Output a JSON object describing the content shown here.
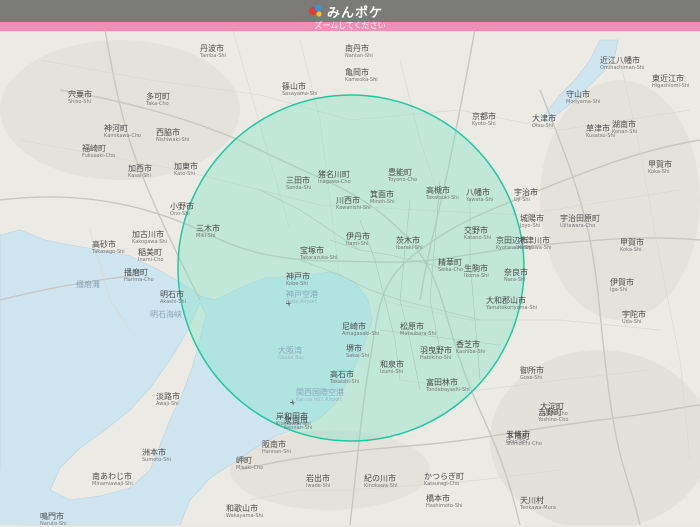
{
  "app": {
    "logo_text": "みんポケ",
    "notice": "ズームしてください",
    "colors": {
      "topbar": "#7a7a76",
      "notice": "#f28fb7",
      "circle_stroke": "#22c9a0",
      "circle_fill": "#7fe3c8",
      "sea": "#cfe6f0",
      "land": "#ebeae4"
    }
  },
  "map": {
    "area_highlight": "range-circle",
    "labels": [
      {
        "ja": "丹波市",
        "en": "Tamba-Shi"
      },
      {
        "ja": "南丹市",
        "en": "Nantan-Shi"
      },
      {
        "ja": "亀岡市",
        "en": "Kameoka-Shi"
      },
      {
        "ja": "京都市",
        "en": "Kyoto-Shi"
      },
      {
        "ja": "近江八幡市",
        "en": "Omihachiman-Shi"
      },
      {
        "ja": "東近江市",
        "en": "Higashiomi-Shi"
      },
      {
        "ja": "守山市",
        "en": "Moriyama-Shi"
      },
      {
        "ja": "大津市",
        "en": "Otsu-Shi"
      },
      {
        "ja": "湖南市",
        "en": "Konan-Shi"
      },
      {
        "ja": "草津市",
        "en": "Kusatsu-Shi"
      },
      {
        "ja": "甲賀市",
        "en": "Koka-Shi"
      },
      {
        "ja": "篠山市",
        "en": "Sasayama-Shi"
      },
      {
        "ja": "多可町",
        "en": "Taka-Cho"
      },
      {
        "ja": "宍粟市",
        "en": "Shiso-Shi"
      },
      {
        "ja": "神河町",
        "en": "Kamikawa-Cho"
      },
      {
        "ja": "西脇市",
        "en": "Nishiwaki-Shi"
      },
      {
        "ja": "福崎町",
        "en": "Fukusaki-Cho"
      },
      {
        "ja": "加東市",
        "en": "Kato-Shi"
      },
      {
        "ja": "加西市",
        "en": "Kasai-Shi"
      },
      {
        "ja": "三田市",
        "en": "Sanda-Shi"
      },
      {
        "ja": "猪名川町",
        "en": "Inagawa-Cho"
      },
      {
        "ja": "豊能町",
        "en": "Toyono-Cho"
      },
      {
        "ja": "箕面市",
        "en": "Minoh-Shi"
      },
      {
        "ja": "川西市",
        "en": "Kawanishi-Shi"
      },
      {
        "ja": "高槻市",
        "en": "Takatsuki-Shi"
      },
      {
        "ja": "八幡市",
        "en": "Yawata-Shi"
      },
      {
        "ja": "宇治市",
        "en": "Uji-Shi"
      },
      {
        "ja": "城陽市",
        "en": "Joyo-Shi"
      },
      {
        "ja": "宇治田原町",
        "en": "Ujitawara-Cho"
      },
      {
        "ja": "甲賀市",
        "en": "Koka-Shi"
      },
      {
        "ja": "三木市",
        "en": "Miki-Shi"
      },
      {
        "ja": "小野市",
        "en": "Ono-Shi"
      },
      {
        "ja": "加古川市",
        "en": "Kakogawa-Shi"
      },
      {
        "ja": "高砂市",
        "en": "Takasago-Shi"
      },
      {
        "ja": "稲美町",
        "en": "Inami-Cho"
      },
      {
        "ja": "播磨町",
        "en": "Harima-Cho"
      },
      {
        "ja": "明石市",
        "en": "Akashi-Shi"
      },
      {
        "ja": "宝塚市",
        "en": "Takarazuka-Shi"
      },
      {
        "ja": "伊丹市",
        "en": "Itami-Shi"
      },
      {
        "ja": "茨木市",
        "en": "Ibaraki-Shi"
      },
      {
        "ja": "交野市",
        "en": "Katano-Shi"
      },
      {
        "ja": "京田辺市",
        "en": "Kyotanabe-Shi"
      },
      {
        "ja": "木津川市",
        "en": "Kizugawa-Shi"
      },
      {
        "ja": "精華町",
        "en": "Seika-Cho"
      },
      {
        "ja": "伊賀市",
        "en": "Iga-Shi"
      },
      {
        "ja": "神戸市",
        "en": "Kobe-Shi"
      },
      {
        "ja": "生駒市",
        "en": "Ikoma-Shi"
      },
      {
        "ja": "奈良市",
        "en": "Nara-Shi"
      },
      {
        "ja": "大和郡山市",
        "en": "Yamatokoriyama-Shi"
      },
      {
        "ja": "尼崎市",
        "en": "Amagasaki-Shi"
      },
      {
        "ja": "松原市",
        "en": "Matsubara-Shi"
      },
      {
        "ja": "堺市",
        "en": "Sakai-Shi"
      },
      {
        "ja": "羽曳野市",
        "en": "Habikino-Shi"
      },
      {
        "ja": "香芝市",
        "en": "Kashiba-Shi"
      },
      {
        "ja": "高石市",
        "en": "Takaishi-Shi"
      },
      {
        "ja": "和泉市",
        "en": "Izumi-Shi"
      },
      {
        "ja": "岸和田市",
        "en": "Kishiwada-Shi"
      },
      {
        "ja": "富田林市",
        "en": "Tondabayashi-Shi"
      },
      {
        "ja": "大淀町",
        "en": "Oyodo-Cho"
      },
      {
        "ja": "宇陀市",
        "en": "Uda-Shi"
      },
      {
        "ja": "御所市",
        "en": "Gose-Shi"
      },
      {
        "ja": "五條市",
        "en": "Gojo-Shi"
      },
      {
        "ja": "淡路市",
        "en": "Awaji-Shi"
      },
      {
        "ja": "洲本市",
        "en": "Sumoto-Shi"
      },
      {
        "ja": "南あわじ市",
        "en": "Minamiawaji-Shi"
      },
      {
        "ja": "泉南市",
        "en": "Sennan-Shi"
      },
      {
        "ja": "阪南市",
        "en": "Hannan-Shi"
      },
      {
        "ja": "岬町",
        "en": "Misaki-Cho"
      },
      {
        "ja": "和歌山市",
        "en": "Wakayama-Shi"
      },
      {
        "ja": "岩出市",
        "en": "Iwade-Shi"
      },
      {
        "ja": "紀の川市",
        "en": "Kinokawa-Shi"
      },
      {
        "ja": "かつらぎ町",
        "en": "Katsuragi-Cho"
      },
      {
        "ja": "橋本市",
        "en": "Hashimoto-Shi"
      },
      {
        "ja": "下市町",
        "en": "Shimoichi-Cho"
      },
      {
        "ja": "吉野町",
        "en": "Yoshino-Cho"
      },
      {
        "ja": "天川村",
        "en": "Tenkawa-Mura"
      },
      {
        "ja": "鳴門市",
        "en": "Naruto-Shi"
      },
      {
        "ja": "大阪湾",
        "en": "Osaka Bay"
      },
      {
        "ja": "神戸空港",
        "en": "Kobe Airport"
      },
      {
        "ja": "関西国際空港",
        "en": "Kansai Int'l Airport"
      },
      {
        "ja": "明石海峡",
        "en": ""
      },
      {
        "ja": "播磨灘",
        "en": ""
      }
    ]
  }
}
